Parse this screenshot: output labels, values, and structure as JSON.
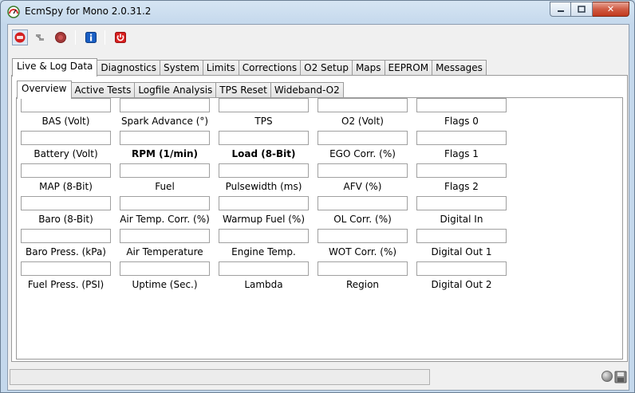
{
  "window": {
    "title": "EcmSpy for Mono 2.0.31.2",
    "close_glyph": "✕"
  },
  "toolbar": {
    "icons": [
      "connect-icon",
      "disconnect-icon",
      "stop-icon",
      "info-icon",
      "power-icon"
    ]
  },
  "main_tabs": [
    {
      "label": "Live & Log Data",
      "active": true
    },
    {
      "label": "Diagnostics"
    },
    {
      "label": "System"
    },
    {
      "label": "Limits"
    },
    {
      "label": "Corrections"
    },
    {
      "label": "O2 Setup"
    },
    {
      "label": "Maps"
    },
    {
      "label": "EEPROM"
    },
    {
      "label": "Messages"
    }
  ],
  "sub_tabs": [
    {
      "label": "Overview",
      "active": true
    },
    {
      "label": "Active Tests"
    },
    {
      "label": "Logfile Analysis"
    },
    {
      "label": "TPS Reset"
    },
    {
      "label": "Wideband-O2"
    }
  ],
  "overview": {
    "columns": [
      [
        {
          "label": "BAS (Volt)",
          "value": ""
        },
        {
          "label": "Battery (Volt)",
          "value": ""
        },
        {
          "label": "MAP (8-Bit)",
          "value": ""
        },
        {
          "label": "Baro (8-Bit)",
          "value": ""
        },
        {
          "label": "Baro Press. (kPa)",
          "value": ""
        },
        {
          "label": "Fuel Press. (PSI)",
          "value": ""
        }
      ],
      [
        {
          "label": "Spark Advance (°)",
          "value": ""
        },
        {
          "label": "RPM (1/min)",
          "value": "",
          "bold": true
        },
        {
          "label": "Fuel",
          "value": ""
        },
        {
          "label": "Air Temp. Corr. (%)",
          "value": ""
        },
        {
          "label": "Air Temperature",
          "value": ""
        },
        {
          "label": "Uptime (Sec.)",
          "value": ""
        }
      ],
      [
        {
          "label": "TPS",
          "value": ""
        },
        {
          "label": "Load (8-Bit)",
          "value": "",
          "bold": true
        },
        {
          "label": "Pulsewidth (ms)",
          "value": ""
        },
        {
          "label": "Warmup Fuel (%)",
          "value": ""
        },
        {
          "label": "Engine Temp.",
          "value": ""
        },
        {
          "label": "Lambda",
          "value": ""
        }
      ],
      [
        {
          "label": "O2 (Volt)",
          "value": ""
        },
        {
          "label": "EGO Corr. (%)",
          "value": ""
        },
        {
          "label": "AFV (%)",
          "value": ""
        },
        {
          "label": "OL Corr. (%)",
          "value": ""
        },
        {
          "label": "WOT Corr. (%)",
          "value": ""
        },
        {
          "label": "Region",
          "value": ""
        }
      ],
      [
        {
          "label": "Flags 0",
          "value": ""
        },
        {
          "label": "Flags 1",
          "value": ""
        },
        {
          "label": "Flags 2",
          "value": ""
        },
        {
          "label": "Digital In",
          "value": ""
        },
        {
          "label": "Digital Out 1",
          "value": ""
        },
        {
          "label": "Digital Out 2",
          "value": ""
        }
      ]
    ]
  },
  "statusbar": {
    "text": ""
  }
}
